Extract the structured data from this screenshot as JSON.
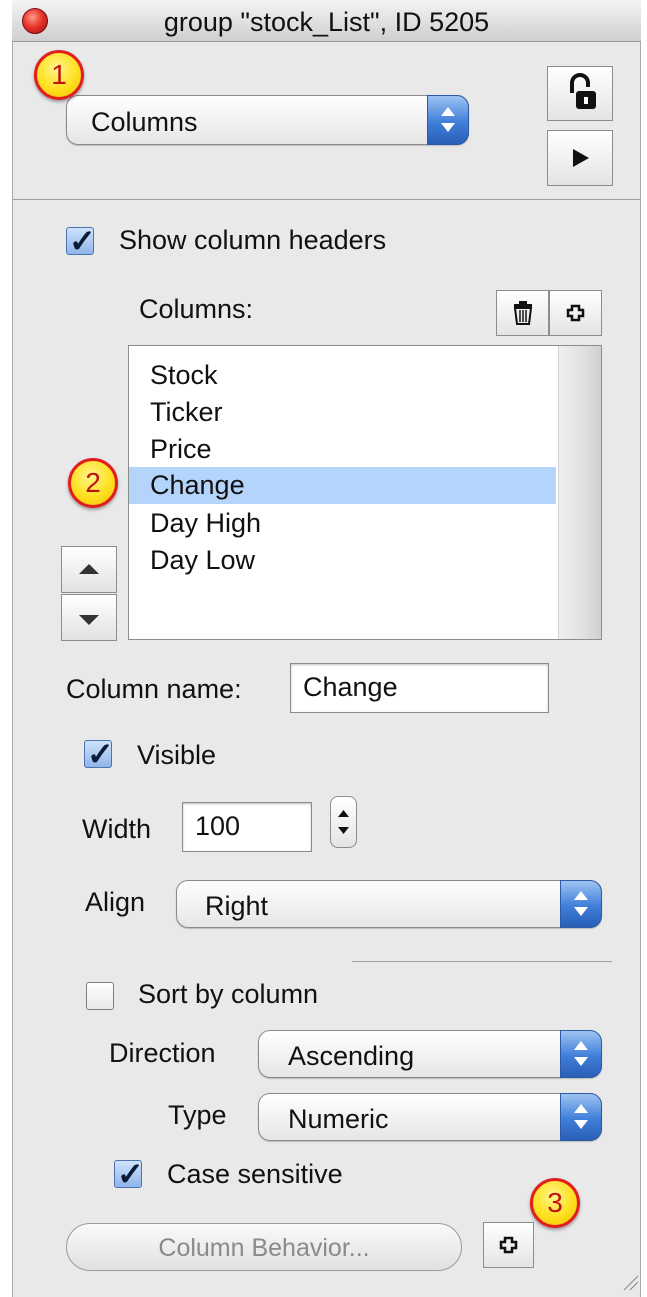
{
  "window": {
    "title": "group \"stock_List\", ID 5205"
  },
  "section_popup": {
    "value": "Columns"
  },
  "show_headers": {
    "label": "Show column headers",
    "checked": true
  },
  "columns": {
    "label": "Columns:",
    "items": [
      "Stock",
      "Ticker",
      "Price",
      "Change",
      "Day High",
      "Day Low"
    ],
    "selected_index": 3
  },
  "column_name": {
    "label": "Column name:",
    "value": "Change"
  },
  "visible": {
    "label": "Visible",
    "checked": true
  },
  "width": {
    "label": "Width",
    "value": "100"
  },
  "align": {
    "label": "Align",
    "value": "Right"
  },
  "sort": {
    "label": "Sort by column",
    "checked": false
  },
  "direction": {
    "label": "Direction",
    "value": "Ascending"
  },
  "type": {
    "label": "Type",
    "value": "Numeric"
  },
  "case_sensitive": {
    "label": "Case sensitive",
    "checked": true
  },
  "column_behavior": {
    "label": "Column Behavior..."
  },
  "badges": [
    "1",
    "2",
    "3"
  ],
  "icons": {
    "lock": "unlocked-padlock-icon",
    "play": "play-icon",
    "trash": "trash-icon",
    "add": "plus-icon"
  },
  "colors": {
    "selection": "#b5d4fc",
    "accent": "#3f7ed9",
    "badge_fill": "#ffe020",
    "badge_ring": "#e21d1d"
  }
}
